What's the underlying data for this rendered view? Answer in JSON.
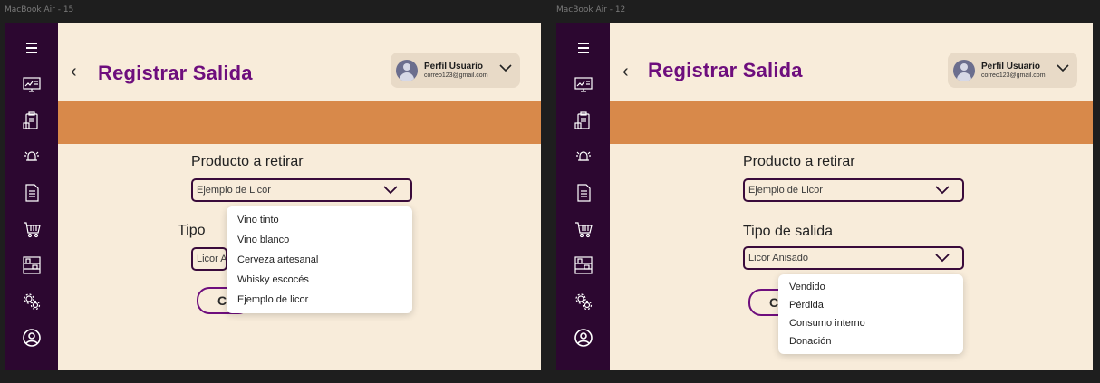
{
  "frames": [
    {
      "label": "MacBook Air - 15",
      "title": "Registrar Salida",
      "profile_name": "Perfil Usuario",
      "profile_email": "correo123@gmail.com",
      "product_label": "Producto a retirar",
      "product_value": "Ejemplo de Licor",
      "type_label": "Tipo",
      "type_value": "Licor A",
      "button_label": "C",
      "dropdown_items": [
        "Vino tinto",
        "Vino blanco",
        "Cerveza artesanal",
        "Whisky escocés",
        "Ejemplo de licor"
      ]
    },
    {
      "label": "MacBook Air - 12",
      "title": "Registrar Salida",
      "profile_name": "Perfil Usuario",
      "profile_email": "correo123@gmail.com",
      "product_label": "Producto a retirar",
      "product_value": "Ejemplo de Licor",
      "type_label": "Tipo de salida",
      "type_value": "Licor Anisado",
      "button_label": "C",
      "dropdown_items": [
        "Vendido",
        "Pérdida",
        "Consumo interno",
        "Donación"
      ]
    }
  ],
  "sidebar_icons": [
    "menu-icon",
    "dashboard-icon",
    "clipboard-icon",
    "alarm-icon",
    "document-icon",
    "shopping-cart-icon",
    "shelves-icon",
    "gears-icon",
    "user-circle-icon"
  ],
  "colors": {
    "sidebar": "#2c0730",
    "background": "#f8ecda",
    "band": "#d8894a",
    "title": "#6e0e7d"
  }
}
